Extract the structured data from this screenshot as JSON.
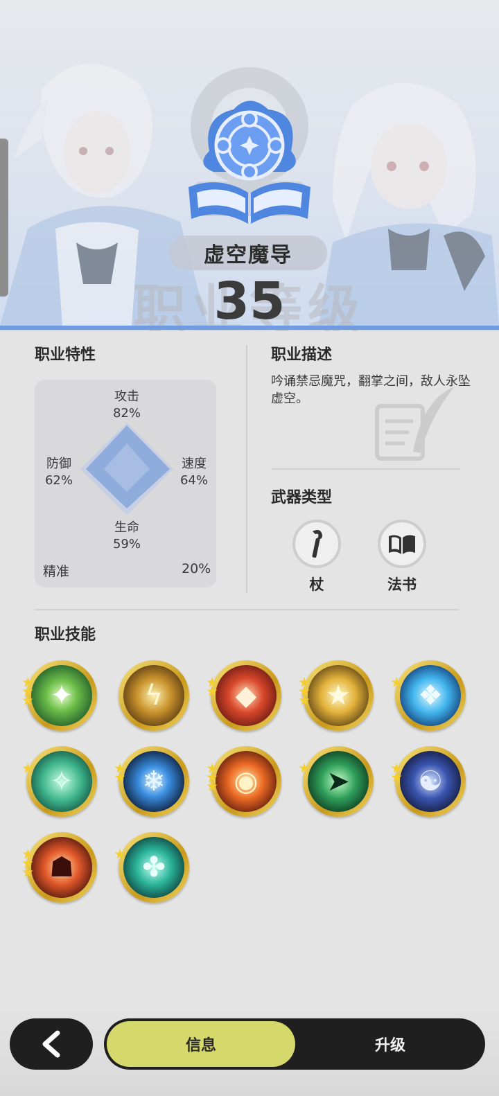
{
  "header": {
    "class_name": "虚空魔导",
    "watermark": "职业等级",
    "level": "35"
  },
  "traits": {
    "title": "职业特性",
    "attack": {
      "label": "攻击",
      "value": "82%"
    },
    "defense": {
      "label": "防御",
      "value": "62%"
    },
    "speed": {
      "label": "速度",
      "value": "64%"
    },
    "life": {
      "label": "生命",
      "value": "59%"
    },
    "precision": {
      "label": "精准",
      "value": "20%"
    }
  },
  "description": {
    "title": "职业描述",
    "text": "吟诵禁忌魔咒，翻掌之间，敌人永坠虚空。"
  },
  "weapons": {
    "title": "武器类型",
    "items": [
      {
        "label": "杖",
        "icon": "staff-icon"
      },
      {
        "label": "法书",
        "icon": "spellbook-icon"
      }
    ]
  },
  "skills": {
    "title": "职业技能",
    "items": [
      {
        "stars": 3,
        "theme": "green-burst"
      },
      {
        "stars": 0,
        "theme": "gold-lightning"
      },
      {
        "stars": 2,
        "theme": "red-diamond"
      },
      {
        "stars": 3,
        "theme": "gold-star"
      },
      {
        "stars": 1,
        "theme": "ice-crystal"
      },
      {
        "stars": 1,
        "theme": "green-shuriken"
      },
      {
        "stars": 2,
        "theme": "blue-snowflake"
      },
      {
        "stars": 3,
        "theme": "fire-vortex"
      },
      {
        "stars": 1,
        "theme": "green-dash"
      },
      {
        "stars": 2,
        "theme": "blue-meditate"
      },
      {
        "stars": 3,
        "theme": "fire-figure"
      },
      {
        "stars": 1,
        "theme": "teal-knot"
      }
    ]
  },
  "nav": {
    "back_icon": "chevron-left-icon",
    "tab_info": "信息",
    "tab_upgrade": "升级"
  },
  "colors": {
    "accent_blue": "#6f9be0",
    "tab_active": "#d5d86a",
    "skill_ring_gold": "#e3bd3c"
  }
}
